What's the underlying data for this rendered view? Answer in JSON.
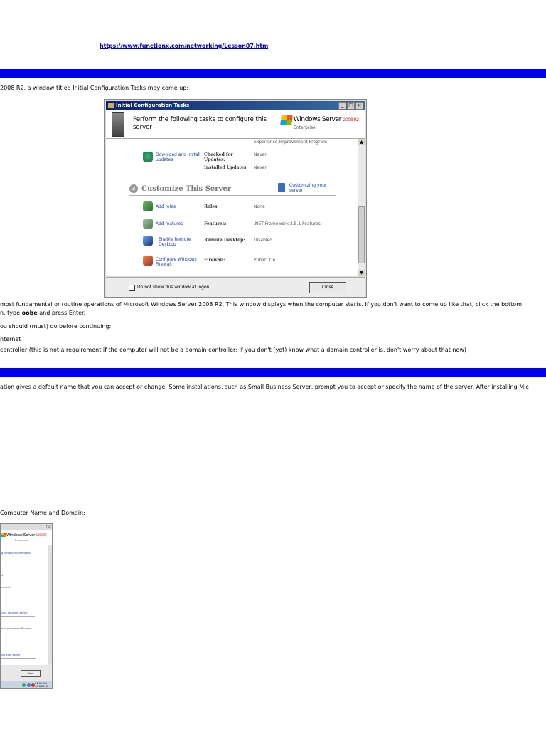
{
  "source_url": "https://www.functionx.com/networking/Lesson07.htm",
  "intro_text": "2008 R2, a window titled Initial Configuration Tasks may come up:",
  "dialog": {
    "title": "Initial Configuration Tasks",
    "header_text": "Perform the following tasks to configure this server",
    "brand": "Windows Server",
    "brand_version": "2008 R2",
    "edition": "Enterprise",
    "top_partial": "Experience Improvement Program",
    "updates_link": "Download and install updates",
    "checked_label": "Checked for Updates:",
    "checked_value": "Never",
    "installed_label": "Installed Updates:",
    "installed_value": "Never",
    "section_number": "3",
    "section_title": "Customize This Server",
    "customizing_link": "Customizing your server",
    "rows": [
      {
        "link": "Add roles",
        "label": "Roles:",
        "value": "None"
      },
      {
        "link": "Add features",
        "label": "Features:",
        "value": ".NET Framework 3.5.1 Features"
      },
      {
        "link": "Enable Remote Desktop",
        "label": "Remote Desktop:",
        "value": "Disabled"
      },
      {
        "link": "Configure Windows Firewall",
        "label": "Firewall:",
        "value": "Public: On"
      }
    ],
    "checkbox_label": "Do not show this window at logon",
    "close_label": "Close"
  },
  "para1_line1": " most fundamental or routine operations of Microsoft Windows Server 2008 R2. This window displays when the computer starts. If you don't want to come up like that, click the bottom",
  "para1_line2_pre": "n, type ",
  "para1_line2_bold": "oobe",
  "para1_line2_post": " and press Enter.",
  "para2": "ou should (must) do before continuing:",
  "item1": "nternet",
  "item2": "controller (this is not a requirement if the computer will not be a domain controller; if you don't (yet) know what a domain controller is, don't worry about that now)",
  "para3": "ation gives a default name that you can accept or change. Some installations, such as Small Business Server, prompt you to accept or specify the name of the server. After installing Mic",
  "para4": "Computer Name and Domain:",
  "small_dialog": {
    "brand": "Windows Server",
    "brand_version": "2008 R2",
    "edition": "Enterprise",
    "line1": "g computer information",
    "line2": "d",
    "line3": "enabled",
    "line4": "your Windows server",
    "line5": "e Improvement Program",
    "line6": "ing your server",
    "close_label": "Close",
    "clock_time": "11:35 AM",
    "clock_date": "4/26/2010"
  }
}
